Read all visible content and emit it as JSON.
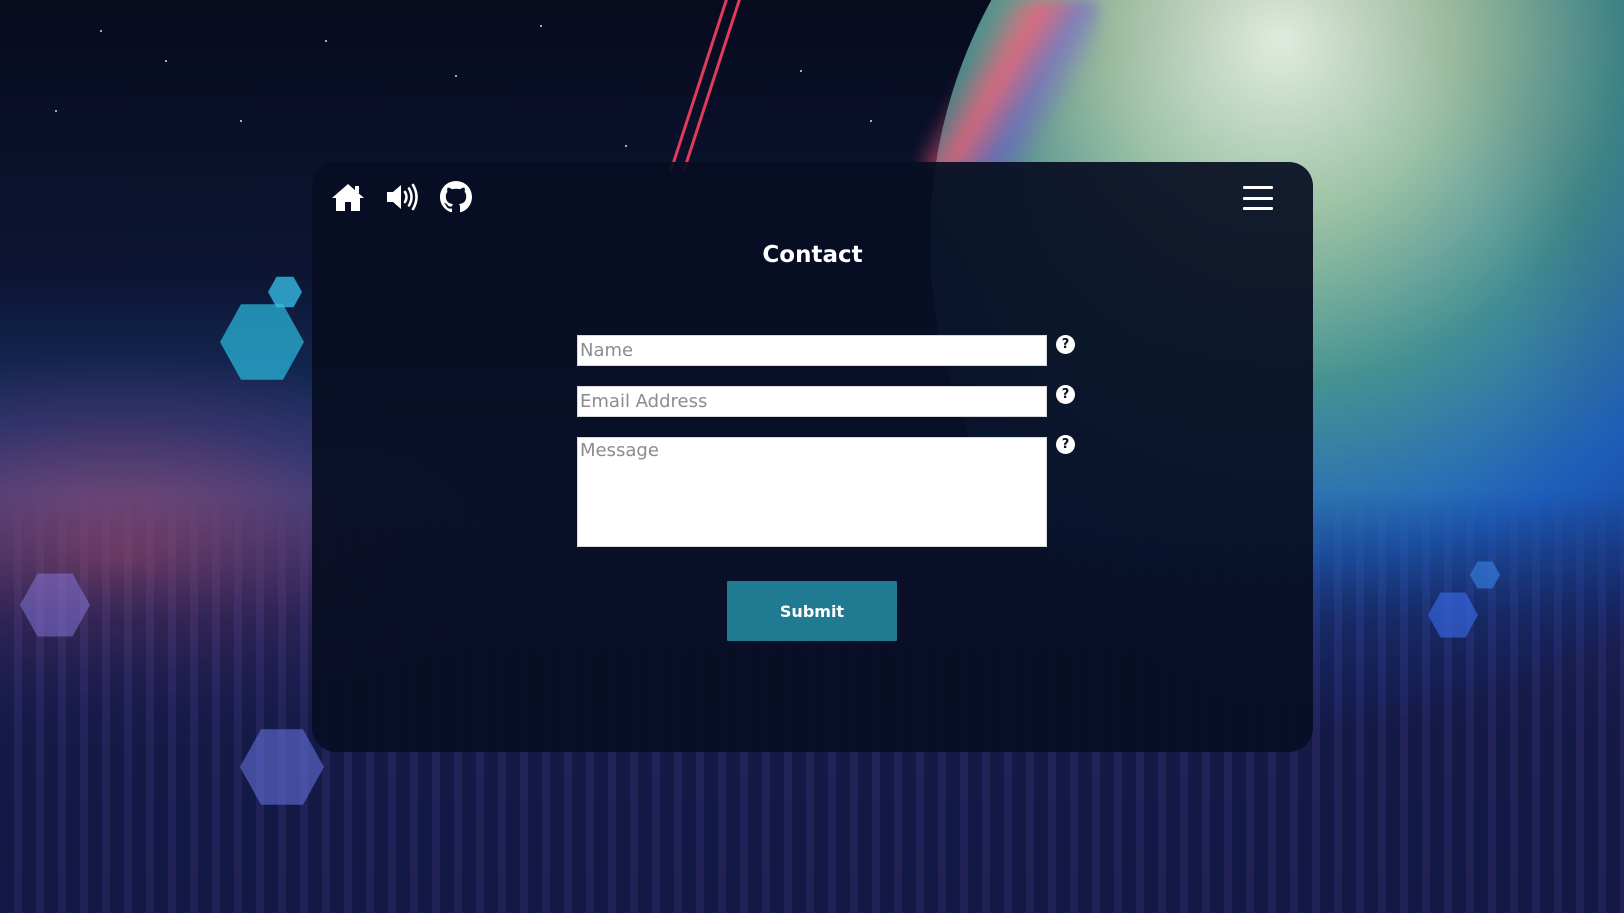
{
  "nav": {
    "icons": [
      "home-icon",
      "volume-icon",
      "github-icon"
    ],
    "menu_icon": "hamburger-menu-icon"
  },
  "contact": {
    "title": "Contact",
    "fields": {
      "name_placeholder": "Name",
      "email_placeholder": "Email Address",
      "message_placeholder": "Message",
      "name_value": "",
      "email_value": "",
      "message_value": ""
    },
    "help_glyph": "?",
    "submit_label": "Submit"
  },
  "colors": {
    "panel_background": "#070e22",
    "accent": "#1f7a92",
    "text": "#ffffff"
  }
}
